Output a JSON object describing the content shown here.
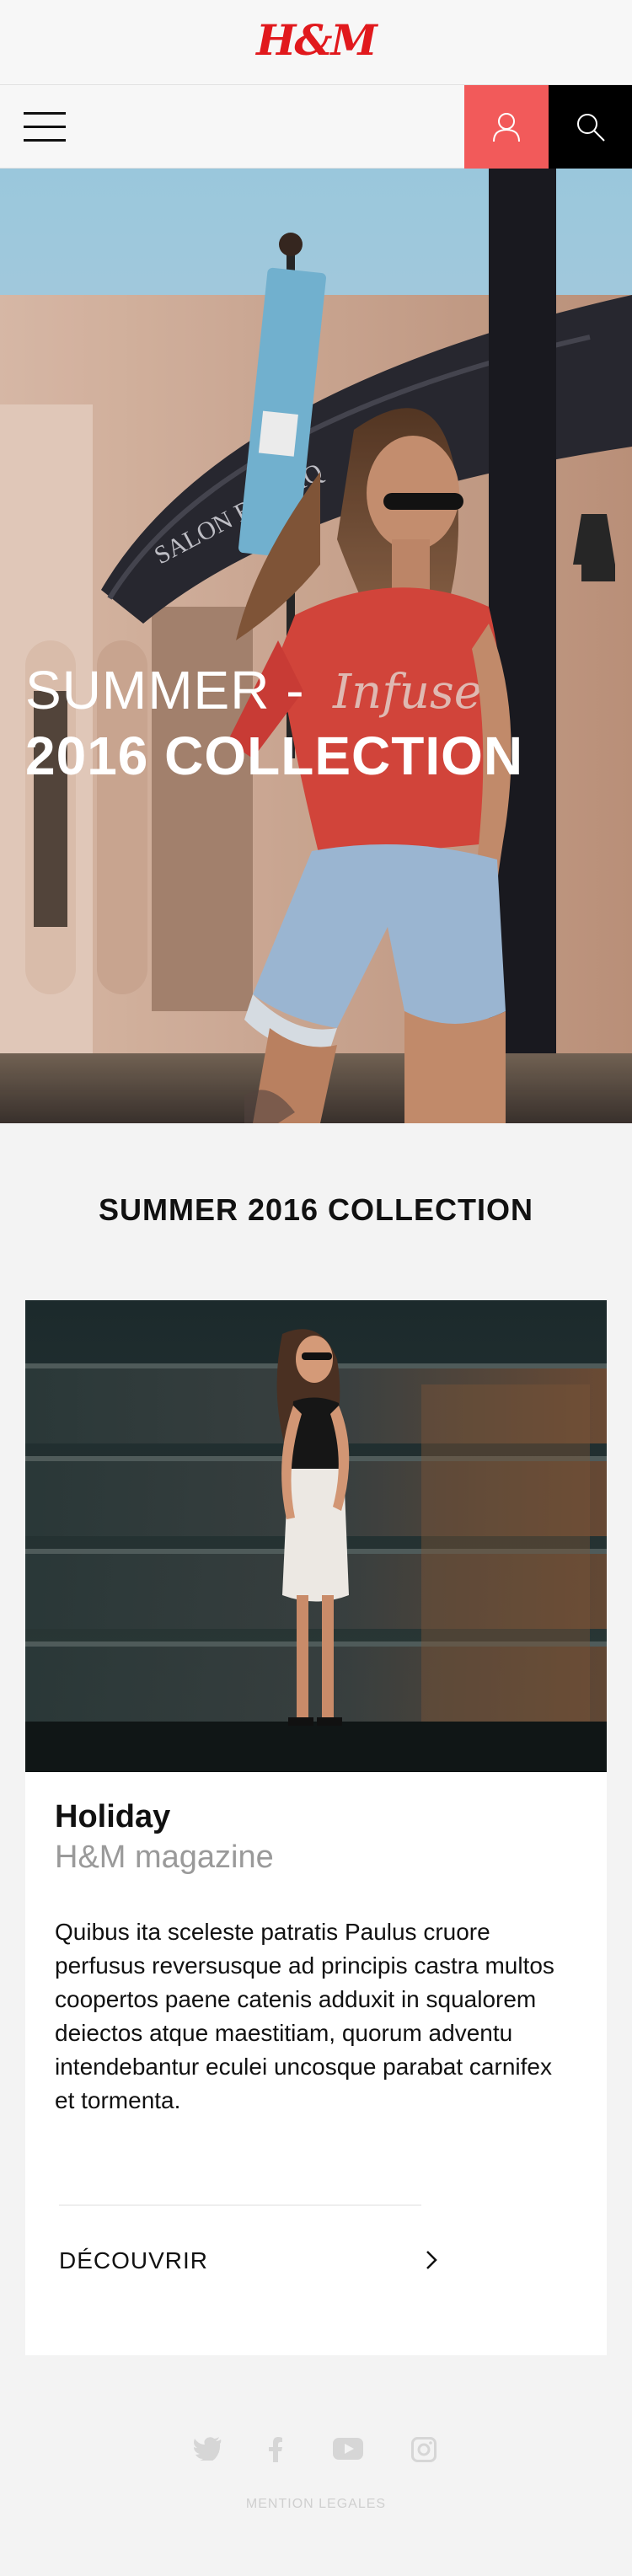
{
  "brand": {
    "logo_text": "H&M",
    "color": "#e1191d"
  },
  "nav": {
    "menu_icon": "hamburger-icon",
    "account_icon": "user-icon",
    "search_icon": "search-icon",
    "account_bg": "#f25a5a",
    "search_bg": "#000000"
  },
  "hero": {
    "title_line1": "SUMMER -",
    "title_line2": "2016 COLLECTION"
  },
  "section": {
    "title": "SUMMER 2016 COLLECTION"
  },
  "card": {
    "title": "Holiday",
    "subtitle": "H&M magazine",
    "body": "Quibus ita sceleste patratis Paulus cruore perfusus reversusque ad principis castra multos coopertos paene catenis adduxit in squalorem deiectos atque maestitiam, quorum adventu intendebantur eculei uncosque parabat carnifex et tormenta.",
    "cta_label": "DÉCOUVRIR",
    "cta_icon": "chevron-right-icon"
  },
  "footer": {
    "social_icons": [
      "twitter-icon",
      "facebook-icon",
      "youtube-icon",
      "instagram-icon"
    ],
    "legal_label": "MENTION LEGALES"
  }
}
